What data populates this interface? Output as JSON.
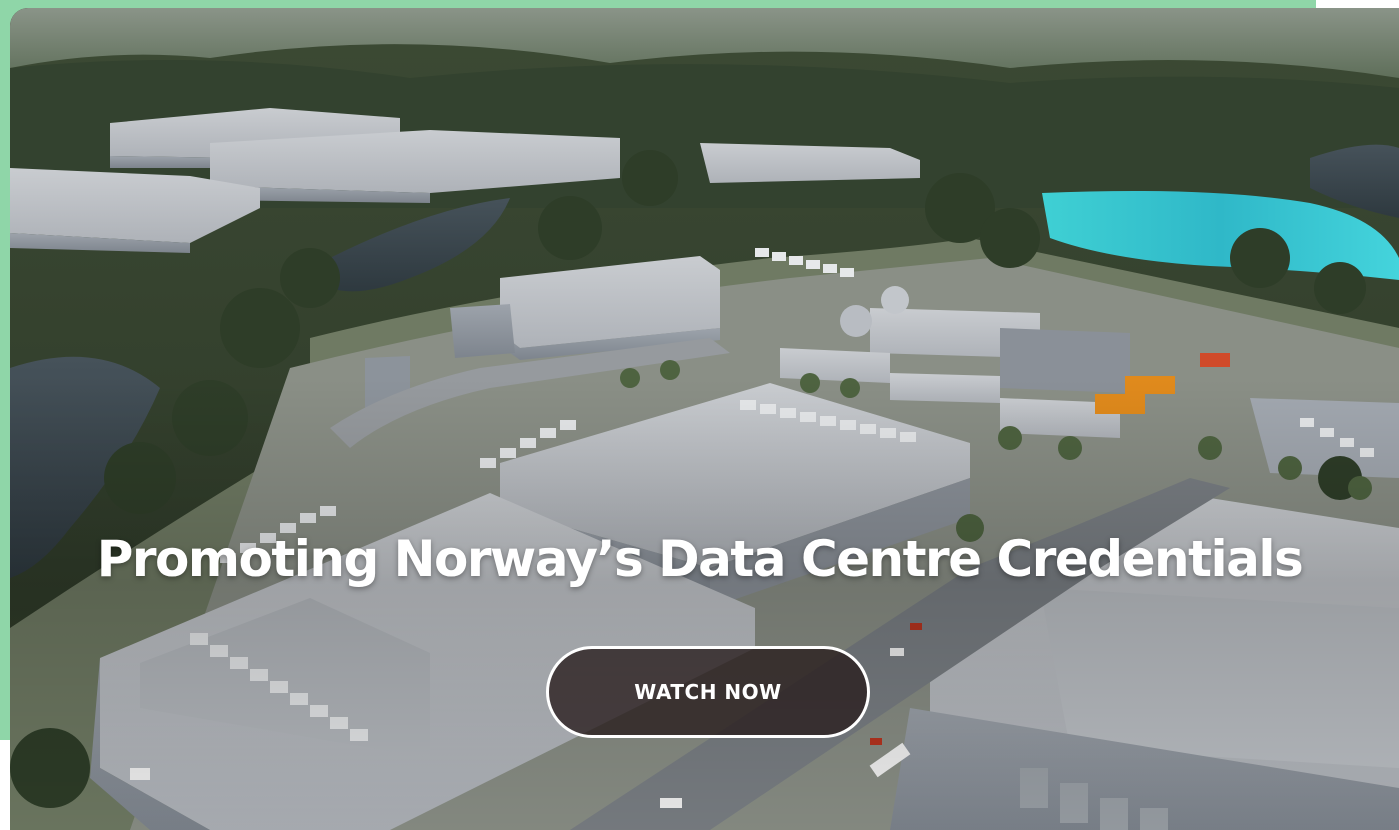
{
  "hero": {
    "title": "Promoting Norway’s Data Centre Credentials",
    "cta_label": "WATCH NOW",
    "image_subject": "aerial-render-data-centre-campus"
  },
  "colors": {
    "accent_frame": "#8fd6a8",
    "button_fill": "#281c1c",
    "button_border": "#ffffff",
    "title_text": "#ffffff"
  }
}
